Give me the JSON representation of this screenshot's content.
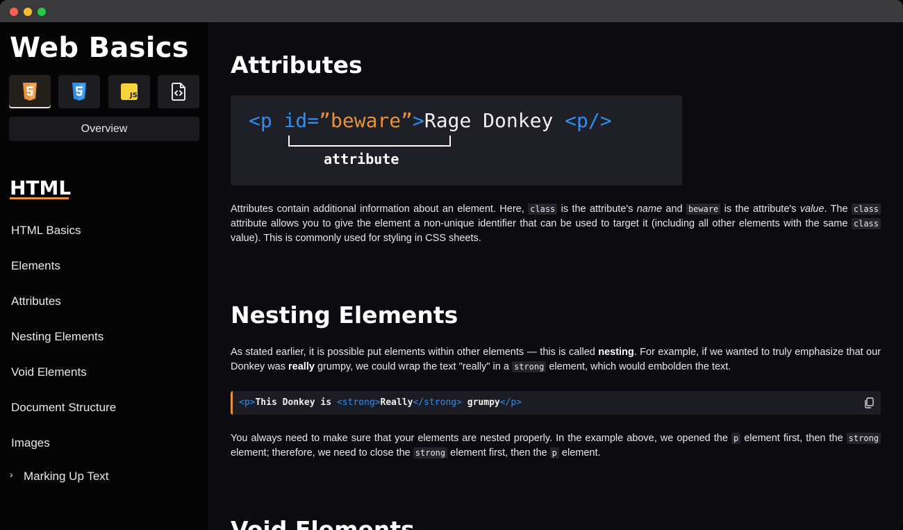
{
  "window": {
    "dots": [
      "close",
      "minimize",
      "maximize"
    ]
  },
  "sidebar": {
    "site_title": "Web Basics",
    "tech_tabs": [
      {
        "name": "html5-icon",
        "active": true,
        "color": "#e8923c"
      },
      {
        "name": "css3-icon",
        "active": false,
        "color": "#2e8ff0"
      },
      {
        "name": "javascript-icon",
        "active": false,
        "color": "#f5d33a",
        "label": "JS"
      },
      {
        "name": "code-file-icon",
        "active": false,
        "color": "#e8e8ec"
      }
    ],
    "overview_label": "Overview",
    "section_heading": "HTML",
    "nav_items": [
      {
        "label": "HTML Basics"
      },
      {
        "label": "Elements"
      },
      {
        "label": "Attributes"
      },
      {
        "label": "Nesting Elements"
      },
      {
        "label": "Void Elements"
      },
      {
        "label": "Document Structure"
      },
      {
        "label": "Images"
      },
      {
        "label": "Marking Up Text",
        "collapsible": true,
        "chevron": "›"
      }
    ]
  },
  "main": {
    "attributes": {
      "heading": "Attributes",
      "diagram": {
        "open_tag": "<p",
        "attr": "id=",
        "value": "”beware”",
        "close_bracket": ">",
        "text": "Rage Donkey",
        "end_tag": "<p/>",
        "bracket_label": "attribute"
      },
      "paragraph": {
        "t1": "Attributes contain additional information about an element. Here,",
        "c1": "class",
        "t2": "is the attribute's",
        "em1": "name",
        "t3": "and",
        "c2": "beware",
        "t4": "is the attribute's",
        "em2": "value",
        "t5": ". The",
        "c3": "class",
        "t6": "attribute allows you to give the element a non-unique identifier that can be used to target it (including all other elements with the same",
        "c4": "class",
        "t7": "value). This is commonly used for styling in CSS sheets."
      }
    },
    "nesting": {
      "heading": "Nesting Elements",
      "paragraph1": {
        "t1": "As stated earlier, it is possible put elements within other elements — this is called",
        "b1": "nesting",
        "t2": ". For example, if we wanted to truly emphasize that our Donkey was",
        "b2": "really",
        "t3": "grumpy, we could wrap the text \"really\" in a",
        "c1": "strong",
        "t4": "element, which would embolden the text."
      },
      "code": {
        "p_open": "<p>",
        "text1": "This Donkey is",
        "strong_open": "<strong>",
        "text2": "Really",
        "strong_close": "</strong>",
        "text3": "grumpy",
        "p_close": "</p>",
        "copy_icon": "copy-icon"
      },
      "paragraph2": {
        "t1": "You always need to make sure that your elements are nested properly. In the example above, we opened the",
        "c1": "p",
        "t2": "element first, then the",
        "c2": "strong",
        "t3": "element; therefore, we need to close the",
        "c3": "strong",
        "t4": "element first, then the",
        "c4": "p",
        "t5": "element."
      }
    },
    "void": {
      "heading": "Void Elements"
    }
  },
  "colors": {
    "accent": "#e8923c",
    "tag_blue": "#2e8ff0",
    "background": "#0b0b10",
    "sidebar": "#050506"
  }
}
